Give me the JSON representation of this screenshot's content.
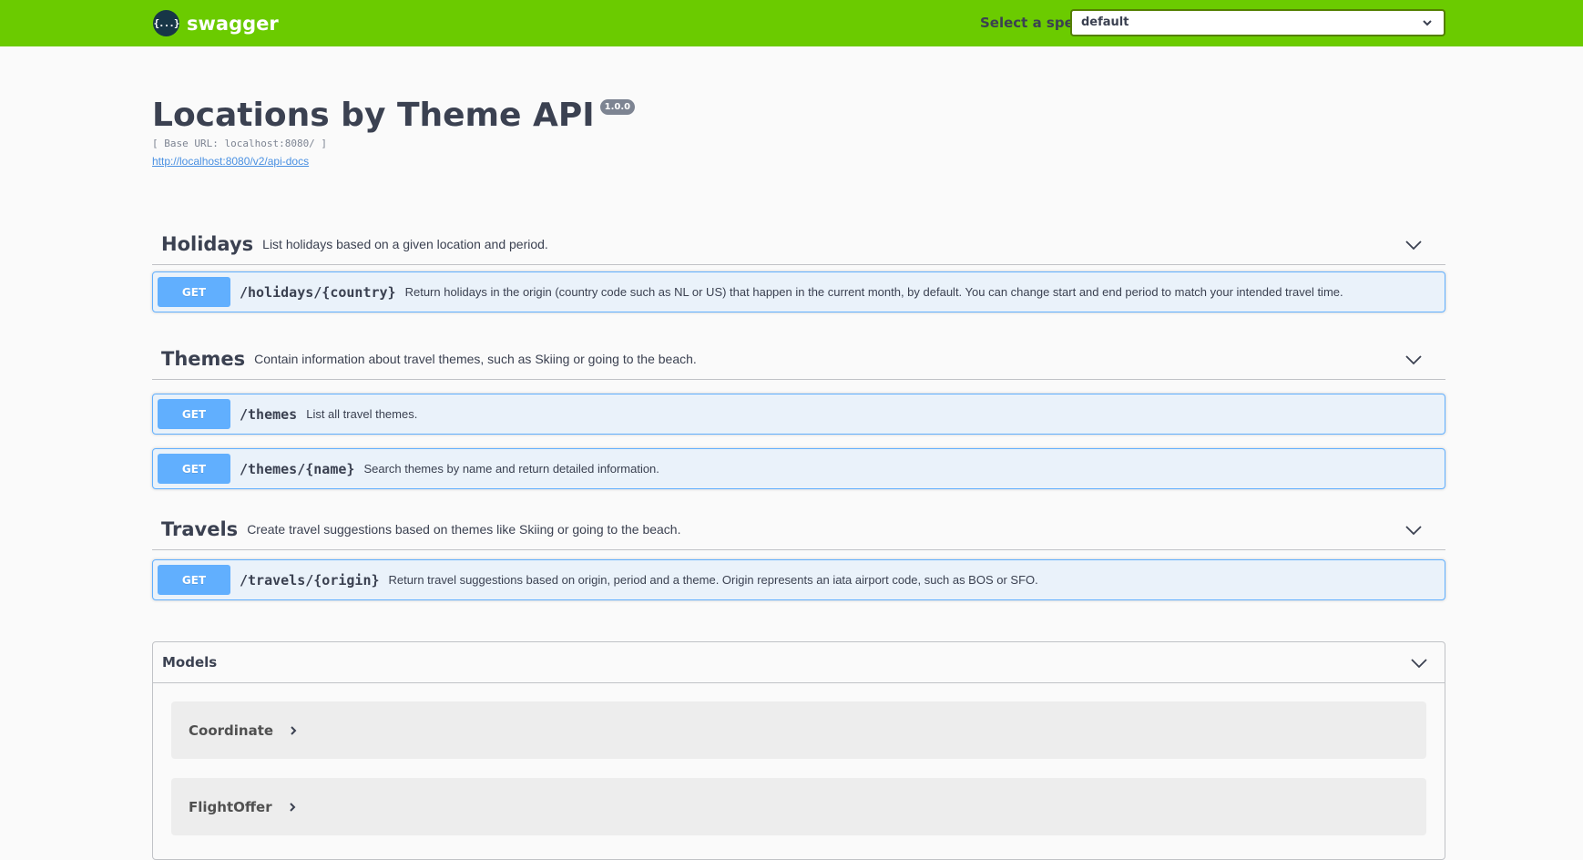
{
  "topbar": {
    "logo_icon": "{...}",
    "logo_text": "swagger",
    "spec_label": "Select a spec",
    "spec_value": "default"
  },
  "info": {
    "title": "Locations by Theme API",
    "version": "1.0.0",
    "base_url": "[ Base URL: localhost:8080/ ]",
    "docs_link": "http://localhost:8080/v2/api-docs"
  },
  "tags": [
    {
      "name": "Holidays",
      "description": "List holidays based on a given location and period.",
      "operations": [
        {
          "method": "GET",
          "path": "/holidays/{country}",
          "summary": "Return holidays in the origin (country code such as NL or US) that happen in the current month, by default. You can change start and end period to match your intended travel time."
        }
      ]
    },
    {
      "name": "Themes",
      "description": "Contain information about travel themes, such as Skiing or going to the beach.",
      "operations": [
        {
          "method": "GET",
          "path": "/themes",
          "summary": "List all travel themes."
        },
        {
          "method": "GET",
          "path": "/themes/{name}",
          "summary": "Search themes by name and return detailed information."
        }
      ]
    },
    {
      "name": "Travels",
      "description": "Create travel suggestions based on themes like Skiing or going to the beach.",
      "operations": [
        {
          "method": "GET",
          "path": "/travels/{origin}",
          "summary": "Return travel suggestions based on origin, period and a theme. Origin represents an iata airport code, such as BOS or SFO."
        }
      ]
    }
  ],
  "models": {
    "title": "Models",
    "items": [
      "Coordinate",
      "FlightOffer"
    ]
  },
  "colors": {
    "topbar": "#6bcb00",
    "get_method": "#61affe",
    "text": "#3b4151"
  }
}
